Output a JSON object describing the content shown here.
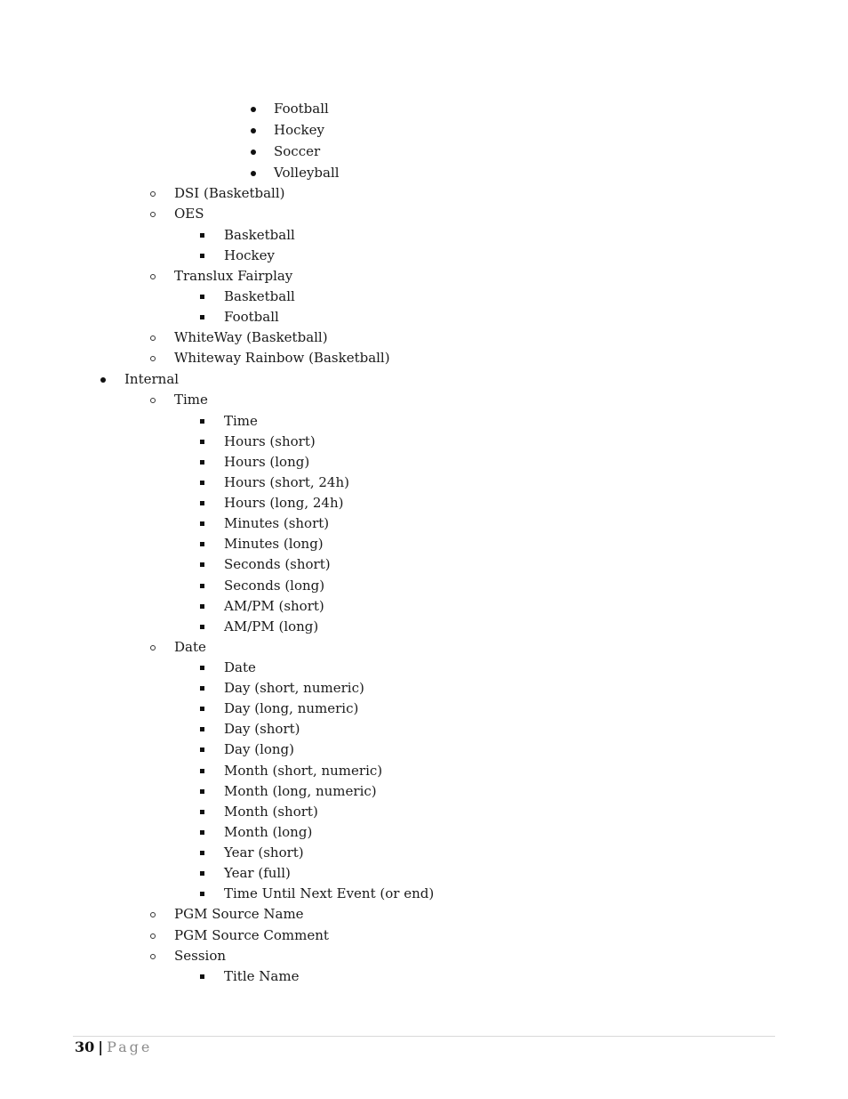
{
  "items": [
    {
      "level": 3,
      "bullet": "disc",
      "text": "Football"
    },
    {
      "level": 3,
      "bullet": "disc",
      "text": "Hockey"
    },
    {
      "level": 3,
      "bullet": "disc",
      "text": "Soccer"
    },
    {
      "level": 3,
      "bullet": "disc",
      "text": "Volleyball"
    },
    {
      "level": 2,
      "bullet": "circle",
      "text": "DSI (Basketball)"
    },
    {
      "level": 2,
      "bullet": "circle",
      "text": "OES"
    },
    {
      "level": 3,
      "bullet": "square",
      "text": "Basketball"
    },
    {
      "level": 3,
      "bullet": "square",
      "text": "Hockey"
    },
    {
      "level": 2,
      "bullet": "circle",
      "text": "Translux Fairplay"
    },
    {
      "level": 3,
      "bullet": "square",
      "text": "Basketball"
    },
    {
      "level": 3,
      "bullet": "square",
      "text": "Football"
    },
    {
      "level": 2,
      "bullet": "circle",
      "text": "WhiteWay (Basketball)"
    },
    {
      "level": 2,
      "bullet": "circle",
      "text": "Whiteway Rainbow (Basketball)"
    },
    {
      "level": 1,
      "bullet": "disc",
      "text": "Internal"
    },
    {
      "level": 2,
      "bullet": "circle",
      "text": "Time"
    },
    {
      "level": 3,
      "bullet": "square",
      "text": "Time"
    },
    {
      "level": 3,
      "bullet": "square",
      "text": "Hours (short)"
    },
    {
      "level": 3,
      "bullet": "square",
      "text": "Hours (long)"
    },
    {
      "level": 3,
      "bullet": "square",
      "text": "Hours (short, 24h)"
    },
    {
      "level": 3,
      "bullet": "square",
      "text": "Hours (long, 24h)"
    },
    {
      "level": 3,
      "bullet": "square",
      "text": "Minutes (short)"
    },
    {
      "level": 3,
      "bullet": "square",
      "text": "Minutes (long)"
    },
    {
      "level": 3,
      "bullet": "square",
      "text": "Seconds (short)"
    },
    {
      "level": 3,
      "bullet": "square",
      "text": "Seconds (long)"
    },
    {
      "level": 3,
      "bullet": "square",
      "text": "AM/PM (short)"
    },
    {
      "level": 3,
      "bullet": "square",
      "text": "AM/PM (long)"
    },
    {
      "level": 2,
      "bullet": "circle",
      "text": "Date"
    },
    {
      "level": 3,
      "bullet": "square",
      "text": "Date"
    },
    {
      "level": 3,
      "bullet": "square",
      "text": "Day (short, numeric)"
    },
    {
      "level": 3,
      "bullet": "square",
      "text": "Day (long, numeric)"
    },
    {
      "level": 3,
      "bullet": "square",
      "text": "Day (short)"
    },
    {
      "level": 3,
      "bullet": "square",
      "text": "Day (long)"
    },
    {
      "level": 3,
      "bullet": "square",
      "text": "Month (short, numeric)"
    },
    {
      "level": 3,
      "bullet": "square",
      "text": "Month (long, numeric)"
    },
    {
      "level": 3,
      "bullet": "square",
      "text": "Month (short)"
    },
    {
      "level": 3,
      "bullet": "square",
      "text": "Month (long)"
    },
    {
      "level": 3,
      "bullet": "square",
      "text": "Year (short)"
    },
    {
      "level": 3,
      "bullet": "square",
      "text": "Year (full)"
    },
    {
      "level": 3,
      "bullet": "square",
      "text": "Time Until Next Event (or end)"
    },
    {
      "level": 2,
      "bullet": "circle",
      "text": "PGM Source Name"
    },
    {
      "level": 2,
      "bullet": "circle",
      "text": "PGM Source Comment"
    },
    {
      "level": 2,
      "bullet": "circle",
      "text": "Session"
    },
    {
      "level": 3,
      "bullet": "square",
      "text": "Title Name"
    }
  ],
  "footer": {
    "page_number": "30",
    "separator": "|",
    "page_label": "Page"
  }
}
